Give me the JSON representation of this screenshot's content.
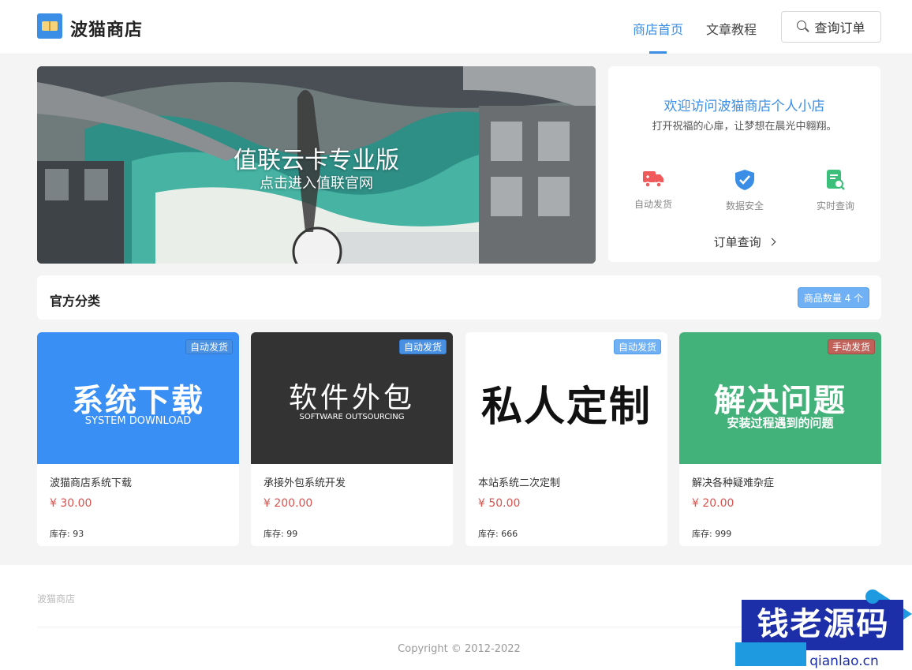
{
  "header": {
    "brand": "波猫商店",
    "nav": [
      {
        "label": "商店首页",
        "active": true
      },
      {
        "label": "文章教程",
        "active": false
      }
    ],
    "query_button": "查询订单"
  },
  "banner": {
    "title": "值联云卡专业版",
    "subtitle": "点击进入值联官网"
  },
  "welcome": {
    "title": "欢迎访问波猫商店个人小店",
    "subtitle": "打开祝福的心扉，让梦想在晨光中翱翔。",
    "features": [
      {
        "label": "自动发货",
        "icon": "truck-icon",
        "color": "#f05a5a"
      },
      {
        "label": "数据安全",
        "icon": "shield-icon",
        "color": "#3a8ee6"
      },
      {
        "label": "实时查询",
        "icon": "document-search-icon",
        "color": "#3cbf7a"
      }
    ],
    "order_link": "订单查询"
  },
  "category": {
    "title": "官方分类",
    "count_label": "商品数量 4 个"
  },
  "products": [
    {
      "thumb_title": "系统下载",
      "thumb_subtitle": "SYSTEM DOWNLOAD",
      "badge": "自动发货",
      "name": "波猫商店系统下载",
      "price": "¥ 30.00",
      "stock": "库存: 93"
    },
    {
      "thumb_title": "软件外包",
      "thumb_subtitle": "SOFTWARE OUTSOURCING",
      "badge": "自动发货",
      "name": "承接外包系统开发",
      "price": "¥ 200.00",
      "stock": "库存: 99"
    },
    {
      "thumb_title": "私人定制",
      "thumb_subtitle": "",
      "badge": "自动发货",
      "name": "本站系统二次定制",
      "price": "¥ 50.00",
      "stock": "库存: 666"
    },
    {
      "thumb_title": "解决问题",
      "thumb_subtitle": "安装过程遇到的问题",
      "badge": "手动发货",
      "name": "解决各种疑难杂症",
      "price": "¥ 20.00",
      "stock": "库存: 999"
    }
  ],
  "footer": {
    "brand": "波猫商店",
    "copyright": "Copyright © 2012-2022"
  },
  "watermark": {
    "text": "钱老源码",
    "url": "qianlao.cn"
  },
  "colors": {
    "accent": "#3a8ee6",
    "price": "#d9534f",
    "badge_auto": "#4a90e2",
    "badge_manual": "#c0625a"
  }
}
